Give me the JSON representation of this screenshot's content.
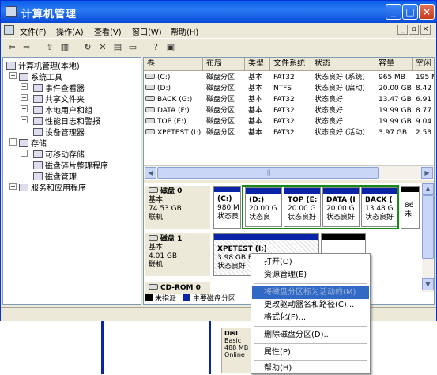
{
  "window": {
    "title": "计算机管理",
    "controls": {
      "minimize": "_",
      "maximize": "□",
      "close": "×"
    }
  },
  "menubar": {
    "items": [
      {
        "label": "文件(F)"
      },
      {
        "label": "操作(A)"
      },
      {
        "label": "查看(V)"
      },
      {
        "label": "窗口(W)"
      },
      {
        "label": "帮助(H)"
      }
    ],
    "mdi_controls": [
      "_",
      "▫",
      "×"
    ]
  },
  "toolbar": {
    "icons": [
      "back-arrow-icon",
      "forward-arrow-icon",
      "up-folder-icon",
      "show-tree-icon",
      "refresh-icon",
      "delete-icon",
      "properties-icon",
      "folder-icon",
      "help-icon",
      "export-icon"
    ],
    "glyphs": [
      "⇦",
      "⇨",
      "⇧",
      "▥",
      "↻",
      "✕",
      "▤",
      "▭",
      "?",
      "▣"
    ]
  },
  "tree": {
    "root": "计算机管理(本地)",
    "system_tools": "系统工具",
    "event_viewer": "事件查看器",
    "shared_folders": "共享文件夹",
    "local_users": "本地用户和组",
    "perf_logs": "性能日志和警报",
    "device_manager": "设备管理器",
    "storage": "存储",
    "removable": "可移动存储",
    "defrag": "磁盘碎片整理程序",
    "disk_mgmt": "磁盘管理",
    "services_apps": "服务和应用程序"
  },
  "volumes": {
    "headers": [
      "卷",
      "布局",
      "类型",
      "文件系统",
      "状态",
      "容量",
      "空闲"
    ],
    "rows": [
      {
        "name": "(C:)",
        "layout": "磁盘分区",
        "type": "基本",
        "fs": "FAT32",
        "status": "状态良好 (系统)",
        "capacity": "965 MB",
        "free": "195 M"
      },
      {
        "name": "(D:)",
        "layout": "磁盘分区",
        "type": "基本",
        "fs": "NTFS",
        "status": "状态良好 (启动)",
        "capacity": "20.00 GB",
        "free": "8.42"
      },
      {
        "name": "BACK (G:)",
        "layout": "磁盘分区",
        "type": "基本",
        "fs": "FAT32",
        "status": "状态良好",
        "capacity": "13.47 GB",
        "free": "6.91"
      },
      {
        "name": "DATA (F:)",
        "layout": "磁盘分区",
        "type": "基本",
        "fs": "FAT32",
        "status": "状态良好",
        "capacity": "19.99 GB",
        "free": "8.77"
      },
      {
        "name": "TOP (E:)",
        "layout": "磁盘分区",
        "type": "基本",
        "fs": "FAT32",
        "status": "状态良好",
        "capacity": "19.99 GB",
        "free": "9.04"
      },
      {
        "name": "XPETEST (I:)",
        "layout": "磁盘分区",
        "type": "基本",
        "fs": "FAT32",
        "status": "状态良好 (活动)",
        "capacity": "3.97 GB",
        "free": "2.53"
      }
    ],
    "scroll_grip": "|||"
  },
  "disks": {
    "disk0": {
      "label": "磁盘 0",
      "type": "基本",
      "size": "74.53 GB",
      "state": "联机",
      "partitions": [
        {
          "name": "(C:)",
          "size": "980 M",
          "status": "状态良"
        },
        {
          "name": "(D:)",
          "size": "20.00 G",
          "status": "状态良"
        },
        {
          "name": "TOP (E:",
          "size": "20.00 G",
          "status": "状态良好"
        },
        {
          "name": "DATA (I",
          "size": "20.00 G",
          "status": "状态良好"
        },
        {
          "name": "BACK (",
          "size": "13.48 G",
          "status": "状态良好"
        },
        {
          "name": "86",
          "size": "",
          "status": "未"
        }
      ]
    },
    "disk1": {
      "label": "磁盘 1",
      "type": "基本",
      "size": "4.01 GB",
      "state": "联机",
      "partitions": [
        {
          "name": "XPETEST (I:)",
          "size": "3.98 GB F",
          "status": "状态良好"
        }
      ]
    },
    "cdrom": {
      "label": "CD-ROM 0"
    }
  },
  "legend": {
    "unallocated": "未指派",
    "primary": "主要磁盘分区"
  },
  "context_menu": {
    "items": [
      {
        "label": "打开(O)",
        "state": "normal"
      },
      {
        "label": "资源管理(E)",
        "state": "normal"
      },
      {
        "label": "将磁盘分区标为活动的(M)",
        "state": "selected-disabled"
      },
      {
        "label": "更改驱动器名和路径(C)...",
        "state": "normal"
      },
      {
        "label": "格式化(F)...",
        "state": "normal"
      },
      {
        "label": "删除磁盘分区(D)...",
        "state": "normal"
      },
      {
        "label": "属性(P)",
        "state": "normal"
      },
      {
        "label": "帮助(H)",
        "state": "normal"
      }
    ]
  },
  "background_window": {
    "title": "Disl",
    "lines": [
      "Basic",
      "488 MB",
      "Online"
    ]
  },
  "colors": {
    "titlebar": "#0a5ee8",
    "primary_partition": "#0a24a8",
    "unallocated": "#000000",
    "selection_outline": "#168a16",
    "menu_highlight": "#316ac5"
  }
}
